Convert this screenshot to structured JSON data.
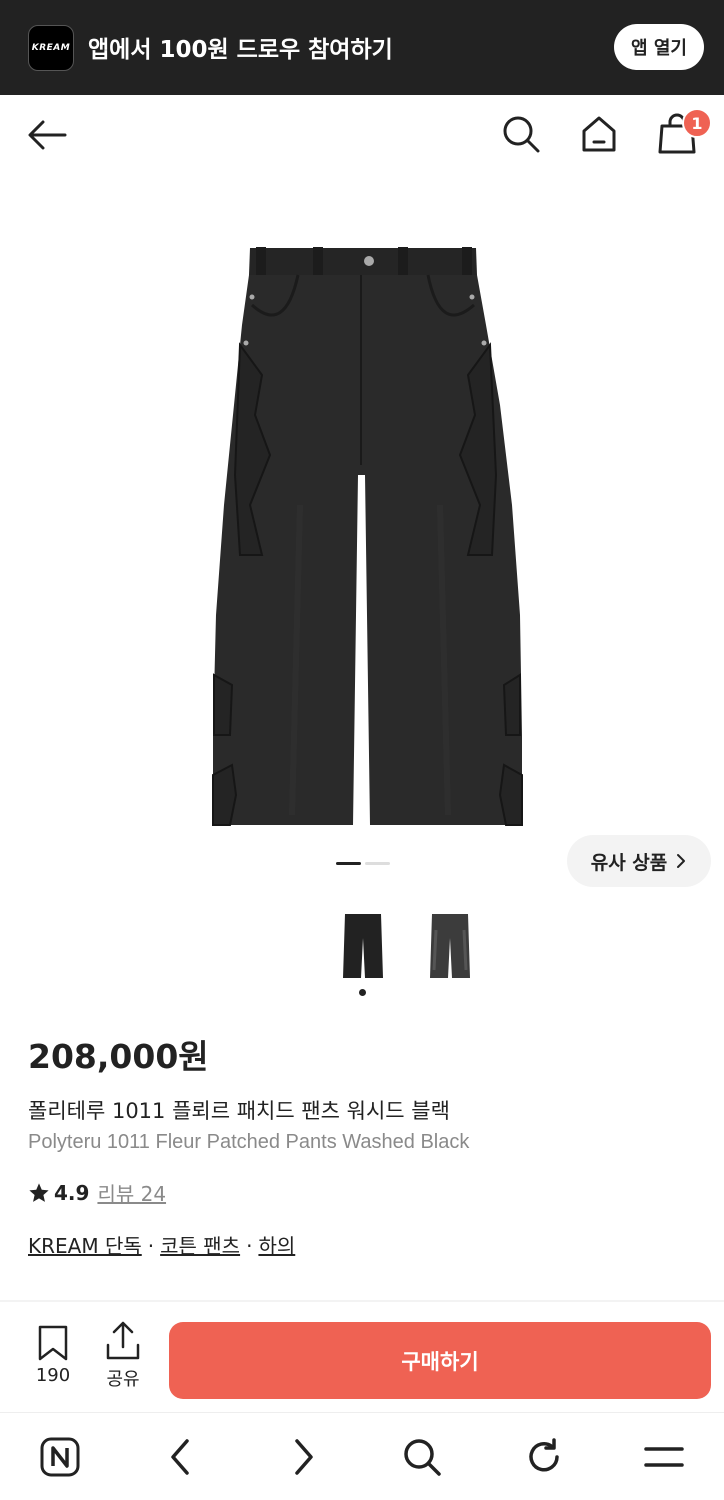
{
  "app_banner": {
    "logo_text": "KREAM",
    "text": "앱에서 100원 드로우 참여하기",
    "open_button": "앱 열기"
  },
  "header": {
    "cart_count": "1",
    "icons": [
      "back-arrow-icon",
      "search-icon",
      "home-icon",
      "shopping-bag-icon"
    ]
  },
  "gallery": {
    "similar_button": "유사 상품",
    "page_index": 1,
    "page_count": 2,
    "thumbnails": [
      "black-pants",
      "washed-black-pants"
    ]
  },
  "product": {
    "price": "208,000원",
    "name_ko": "폴리테루 1011 플뢰르 패치드 팬츠 워시드 블랙",
    "name_en": "Polyteru 1011 Fleur Patched Pants Washed Black",
    "rating": "4.9",
    "review_label": "리뷰 24",
    "tags": [
      "KREAM 단독",
      "코튼 팬츠",
      "하의"
    ],
    "tag_separator": "·"
  },
  "action_bar": {
    "bookmark_count": "190",
    "share_label": "공유",
    "buy_label": "구매하기",
    "buy_color": "#ef6253"
  },
  "browser_nav": {
    "icons": [
      "naver-n-icon",
      "back-chevron-icon",
      "forward-chevron-icon",
      "search-icon",
      "refresh-icon",
      "menu-icon"
    ]
  }
}
